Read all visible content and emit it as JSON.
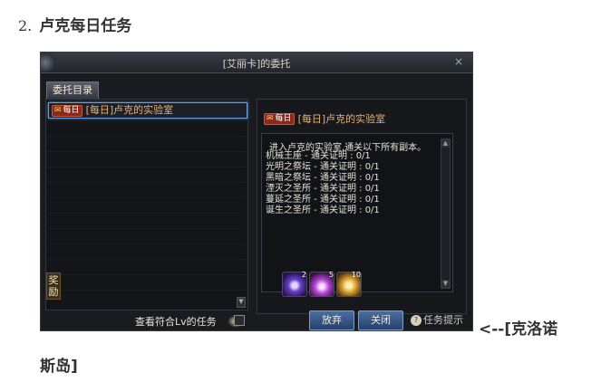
{
  "section": {
    "number": "2.",
    "title": "卢克每日任务"
  },
  "window": {
    "title": "[艾丽卡]的委托",
    "close_label": "×",
    "tab_label": "委托目录"
  },
  "quest_list": {
    "items": [
      {
        "badge": "每日",
        "label": "[每日]卢克的实验室"
      }
    ],
    "checkbox_label": "查看符合Lv的任务"
  },
  "detail": {
    "badge": "每日",
    "title": "[每日]卢克的实验室",
    "intro": "进入卢克的实验室,通关以下所有副本。",
    "requirements": [
      "机械王座 - 通关证明 : 0/1",
      "光明之祭坛 - 通关证明 : 0/1",
      "黑暗之祭坛 - 通关证明 : 0/1",
      "湮灭之圣所 - 通关证明 : 0/1",
      "蔓延之圣所 - 通关证明 : 0/1",
      "诞生之圣所 - 通关证明 : 0/1"
    ],
    "reward_label": "奖励",
    "rewards": [
      {
        "icon": "purple-orb-icon",
        "count": "2"
      },
      {
        "icon": "pink-crystal-icon",
        "count": "5"
      },
      {
        "icon": "gold-item-icon",
        "count": "10"
      }
    ]
  },
  "buttons": {
    "abandon": "放弃",
    "close": "关闭",
    "hint": "任务提示"
  },
  "caption": {
    "line1": "<--[克洛诺",
    "line2": "斯岛]"
  }
}
